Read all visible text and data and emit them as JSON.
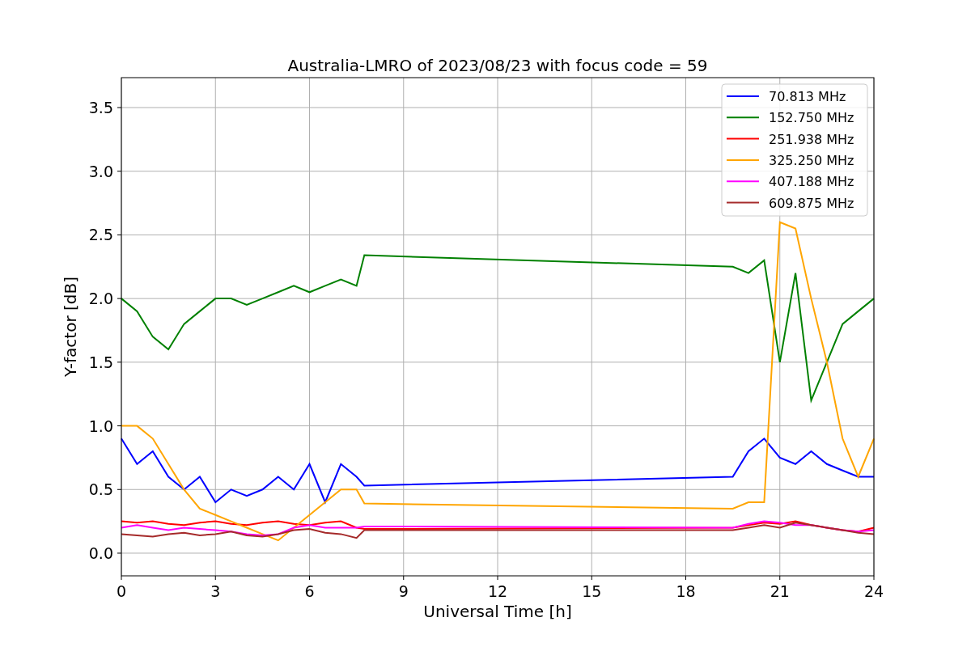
{
  "chart_data": {
    "type": "line",
    "title": "Australia-LMRO of 2023/08/23 with focus code = 59",
    "xlabel": "Universal Time [h]",
    "ylabel": "Y-factor [dB]",
    "x": [
      0,
      0.5,
      1,
      1.5,
      2,
      2.5,
      3,
      3.5,
      4,
      4.5,
      5,
      5.5,
      6,
      6.5,
      7,
      7.5,
      7.75,
      19.5,
      20,
      20.5,
      21,
      21.5,
      22,
      22.5,
      23,
      23.5,
      24
    ],
    "series": [
      {
        "name": "70.813 MHz",
        "color": "#0000ff",
        "values": [
          0.9,
          0.7,
          0.8,
          0.6,
          0.5,
          0.6,
          0.4,
          0.5,
          0.45,
          0.5,
          0.6,
          0.5,
          0.7,
          0.4,
          0.7,
          0.6,
          0.53,
          0.6,
          0.8,
          0.9,
          0.75,
          0.7,
          0.8,
          0.7,
          0.65,
          0.6,
          0.6
        ]
      },
      {
        "name": "152.750 MHz",
        "color": "#008000",
        "values": [
          2.0,
          1.9,
          1.7,
          1.6,
          1.8,
          1.9,
          2.0,
          2.0,
          1.95,
          2.0,
          2.05,
          2.1,
          2.05,
          2.1,
          2.15,
          2.1,
          2.34,
          2.25,
          2.2,
          2.3,
          1.5,
          2.2,
          1.2,
          1.5,
          1.8,
          1.9,
          2.0
        ]
      },
      {
        "name": "251.938 MHz",
        "color": "#ff0000",
        "values": [
          0.25,
          0.24,
          0.25,
          0.23,
          0.22,
          0.24,
          0.25,
          0.23,
          0.22,
          0.24,
          0.25,
          0.23,
          0.22,
          0.24,
          0.25,
          0.2,
          0.19,
          0.2,
          0.22,
          0.24,
          0.23,
          0.25,
          0.22,
          0.2,
          0.18,
          0.17,
          0.2
        ]
      },
      {
        "name": "325.250 MHz",
        "color": "#ffa500",
        "values": [
          1.0,
          1.0,
          0.9,
          0.7,
          0.5,
          0.35,
          0.3,
          0.25,
          0.2,
          0.15,
          0.1,
          0.2,
          0.3,
          0.4,
          0.5,
          0.5,
          0.39,
          0.35,
          0.4,
          0.4,
          2.6,
          2.55,
          2.0,
          1.5,
          0.9,
          0.6,
          0.9
        ]
      },
      {
        "name": "407.188 MHz",
        "color": "#ff00ff",
        "values": [
          0.2,
          0.22,
          0.2,
          0.18,
          0.2,
          0.19,
          0.18,
          0.17,
          0.15,
          0.14,
          0.15,
          0.2,
          0.22,
          0.2,
          0.2,
          0.2,
          0.21,
          0.2,
          0.23,
          0.25,
          0.24,
          0.22,
          0.22,
          0.2,
          0.18,
          0.17,
          0.18
        ]
      },
      {
        "name": "609.875 MHz",
        "color": "#a52a2a",
        "values": [
          0.15,
          0.14,
          0.13,
          0.15,
          0.16,
          0.14,
          0.15,
          0.17,
          0.14,
          0.13,
          0.15,
          0.18,
          0.19,
          0.16,
          0.15,
          0.12,
          0.18,
          0.18,
          0.2,
          0.22,
          0.2,
          0.24,
          0.22,
          0.2,
          0.18,
          0.16,
          0.15
        ]
      }
    ],
    "xlim": [
      0,
      24
    ],
    "ylim": [
      -0.178,
      3.735
    ],
    "xticks": [
      0,
      3,
      6,
      9,
      12,
      15,
      18,
      21,
      24
    ],
    "yticks": [
      {
        "value": 0,
        "label": "0.0"
      },
      0.5,
      {
        "value": 1,
        "label": "1.0"
      },
      1.5,
      {
        "value": 2,
        "label": "2.0"
      },
      2.5,
      {
        "value": 3,
        "label": "3.0"
      },
      3.5
    ],
    "grid": true,
    "legend": true
  }
}
